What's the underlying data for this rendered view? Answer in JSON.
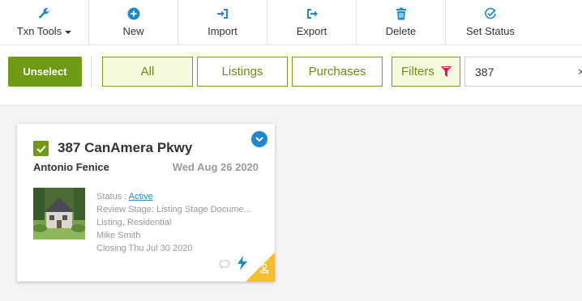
{
  "toolbar": {
    "items": [
      {
        "label": "Txn Tools",
        "icon": "wrench-icon"
      },
      {
        "label": "New",
        "icon": "plus-circle-icon"
      },
      {
        "label": "Import",
        "icon": "import-icon"
      },
      {
        "label": "Export",
        "icon": "export-icon"
      },
      {
        "label": "Delete",
        "icon": "trash-icon"
      },
      {
        "label": "Set Status",
        "icon": "check-circle-icon"
      }
    ]
  },
  "filterbar": {
    "unselect_label": "Unselect",
    "tabs": [
      {
        "label": "All",
        "active": true
      },
      {
        "label": "Listings",
        "active": false
      },
      {
        "label": "Purchases",
        "active": false
      }
    ],
    "filters_label": "Filters",
    "search_value": "387"
  },
  "card": {
    "address": "387 CanAmera Pkwy",
    "agent": "Antonio Fenice",
    "date": "Wed Aug 26 2020",
    "status_label": "Status :",
    "status_value": "Active",
    "review_stage": "Review Stage: Listing Stage Docume...",
    "type": "Listing, Residential",
    "agent2": "Mike Smith",
    "closing": "Closing Thu Jul 30 2020",
    "checked": true
  },
  "colors": {
    "accent_green": "#6f9a14",
    "accent_blue": "#1e88c9",
    "filter_pink": "#d6195f",
    "corner_yellow": "#f6bd2c"
  }
}
